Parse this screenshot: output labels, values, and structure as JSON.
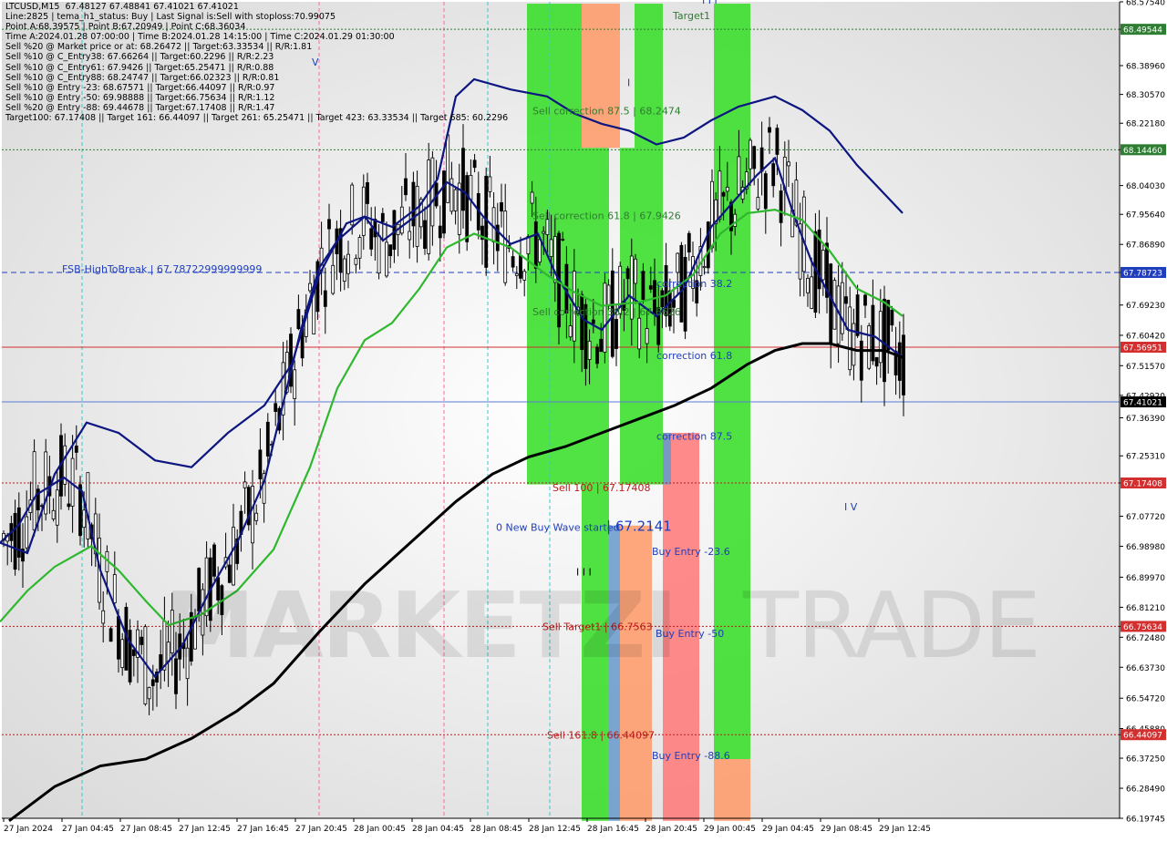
{
  "info": {
    "lines": [
      "LTCUSD,M15  67.48127 67.48841 67.41021 67.41021",
      "Line:2825 | tema_h1_status: Buy | Last Signal is:Sell with stoploss:70.99075",
      "Point A:68.39575 | Point B:67.20949 | Point C:68.36034",
      "Time A:2024.01.28 07:00:00 | Time B:2024.01.28 14:15:00 | Time C:2024.01.29 01:30:00",
      "Sell %20 @ Market price or at: 68.26472 || Target:63.33534 || R/R:1.81",
      "Sell %10 @ C_Entry38: 67.66264 || Target:60.2296 || R/R:2.23",
      "Sell %10 @ C_Entry61: 67.9426 || Target:65.25471 || R/R:0.88",
      "Sell %10 @ C_Entry88: 68.24747 || Target:66.02323 || R/R:0.81",
      "Sell %10 @ Entry -23: 68.67571 || Target:66.44097 || R/R:0.97",
      "Sell %10 @ Entry -50: 69.98888 || Target:66.75634 || R/R:1.12",
      "Sell %20 @ Entry -88: 69.44678 || Target:67.17408 || R/R:1.47",
      "Target100: 67.17408 || Target 161: 66.44097 || Target 261: 65.25471 || Target 423: 63.33534 || Target 685: 60.2296"
    ]
  },
  "watermark": {
    "left": "MARKETZI",
    "right": "TRADE"
  },
  "chart_data": {
    "type": "candlestick",
    "symbol": "LTCUSD",
    "timeframe": "M15",
    "ylim": [
      66.19745,
      68.5754
    ],
    "y_ticks": [
      "68.57540",
      "68.49544",
      "68.38960",
      "68.30570",
      "68.22180",
      "68.14460",
      "68.04030",
      "67.95640",
      "67.86890",
      "67.78723",
      "67.69230",
      "67.60420",
      "67.51570",
      "67.42920",
      "67.36390",
      "67.25310",
      "67.17408",
      "67.07720",
      "66.98980",
      "66.89970",
      "66.81210",
      "66.75634",
      "66.72480",
      "66.63730",
      "66.54720",
      "66.45880",
      "66.44097",
      "66.37250",
      "66.28490",
      "66.19745"
    ],
    "x_ticks": [
      "27 Jan 2024",
      "27 Jan 04:45",
      "27 Jan 08:45",
      "27 Jan 12:45",
      "27 Jan 16:45",
      "27 Jan 20:45",
      "28 Jan 00:45",
      "28 Jan 04:45",
      "28 Jan 08:45",
      "28 Jan 12:45",
      "28 Jan 16:45",
      "28 Jan 20:45",
      "29 Jan 00:45",
      "29 Jan 04:45",
      "29 Jan 08:45",
      "29 Jan 12:45"
    ],
    "current_price": 67.41021,
    "price_tags": [
      {
        "value": 68.49544,
        "label": "68.49544",
        "color": "#2e7d32"
      },
      {
        "value": 68.1446,
        "label": "68.14460",
        "color": "#2e7d32"
      },
      {
        "value": 67.78723,
        "label": "67.78723",
        "color": "#1f3fbf"
      },
      {
        "value": 67.56951,
        "label": "67.56951",
        "color": "#d32f2f"
      },
      {
        "value": 67.41021,
        "label": "67.41021",
        "color": "#000000"
      },
      {
        "value": 67.17408,
        "label": "67.17408",
        "color": "#d32f2f"
      },
      {
        "value": 66.75634,
        "label": "66.75634",
        "color": "#d32f2f"
      },
      {
        "value": 66.44097,
        "label": "66.44097",
        "color": "#d32f2f"
      }
    ],
    "levels": [
      {
        "value": 68.49544,
        "style": "dotted",
        "color": "#2e7d32"
      },
      {
        "value": 68.1446,
        "style": "dotted",
        "color": "#2e7d32"
      },
      {
        "value": 67.78723,
        "style": "dashed",
        "color": "#1f3fbf"
      },
      {
        "value": 67.56951,
        "style": "solid",
        "color": "#d32f2f"
      },
      {
        "value": 67.41021,
        "style": "solid",
        "color": "#5a7bd6"
      },
      {
        "value": 67.17408,
        "style": "dotted",
        "color": "#b71c1c"
      },
      {
        "value": 66.75634,
        "style": "dotted",
        "color": "#b71c1c"
      },
      {
        "value": 66.44097,
        "style": "dotted",
        "color": "#b71c1c"
      }
    ],
    "annotations": [
      {
        "text": "FSB-HighToBreak | 67.78722999999999",
        "y": 67.78723,
        "color": "#1f3fbf"
      },
      {
        "text": "Target1",
        "y": 68.525,
        "color": "#2e7d32"
      },
      {
        "text": "Sell correction 87.5 | 68.2474",
        "y": 68.2474,
        "color": "#2e7d32"
      },
      {
        "text": "Sell correction 61.8 | 67.9426",
        "y": 67.9426,
        "color": "#2e7d32"
      },
      {
        "text": "Sell correction 38.2 | 67.6626",
        "y": 67.6626,
        "color": "#2e7d32"
      },
      {
        "text": "correction 38.2",
        "y": 67.745,
        "color": "#1f3fbf"
      },
      {
        "text": "correction 61.8",
        "y": 67.535,
        "color": "#1f3fbf"
      },
      {
        "text": "correction 87.5",
        "y": 67.3,
        "color": "#1f3fbf"
      },
      {
        "text": "Sell 100 | 67.17408",
        "y": 67.15,
        "color": "#b71c1c"
      },
      {
        "text": "0 New Buy Wave started",
        "y": 67.035,
        "color": "#1f3fbf"
      },
      {
        "text": "| 67.2141",
        "y": 67.035,
        "color": "#1f3fbf"
      },
      {
        "text": "Buy Entry -23.6",
        "y": 66.965,
        "color": "#1f3fbf"
      },
      {
        "text": "Sell Target1 | 66.7563",
        "y": 66.745,
        "color": "#b71c1c"
      },
      {
        "text": "Buy Entry -50",
        "y": 66.725,
        "color": "#1f3fbf"
      },
      {
        "text": "Sell 161.8 | 66.44097",
        "y": 66.43,
        "color": "#b71c1c"
      },
      {
        "text": "Buy Entry -88.6",
        "y": 66.37,
        "color": "#1f3fbf"
      },
      {
        "text": "V",
        "y": 68.39,
        "color": "#1f3fbf"
      },
      {
        "text": "I V",
        "y": 67.095,
        "color": "#1f3fbf"
      },
      {
        "text": "I",
        "y": 68.33,
        "color": "#1f3fbf"
      },
      {
        "text": "I I I",
        "y": 68.57,
        "color": "#1f3fbf"
      },
      {
        "text": "I I I",
        "y": 66.905,
        "color": "#000000"
      }
    ],
    "series": [
      {
        "name": "",
        "color": "#0d1680",
        "points": [
          [
            0,
            67.0
          ],
          [
            30,
            66.97
          ],
          [
            60,
            67.2
          ],
          [
            95,
            67.35
          ],
          [
            130,
            67.32
          ],
          [
            170,
            67.24
          ],
          [
            210,
            67.22
          ],
          [
            250,
            67.32
          ],
          [
            290,
            67.4
          ],
          [
            320,
            67.52
          ],
          [
            350,
            67.78
          ],
          [
            380,
            67.93
          ],
          [
            400,
            67.95
          ],
          [
            430,
            67.92
          ],
          [
            460,
            67.98
          ],
          [
            480,
            68.06
          ],
          [
            500,
            68.3
          ],
          [
            520,
            68.35
          ],
          [
            560,
            68.32
          ],
          [
            600,
            68.3
          ],
          [
            630,
            68.25
          ],
          [
            660,
            68.22
          ],
          [
            690,
            68.2
          ],
          [
            720,
            68.16
          ],
          [
            750,
            68.18
          ],
          [
            780,
            68.23
          ],
          [
            810,
            68.27
          ],
          [
            850,
            68.3
          ],
          [
            880,
            68.26
          ],
          [
            910,
            68.2
          ],
          [
            940,
            68.1
          ],
          [
            965,
            68.03
          ],
          [
            990,
            67.96
          ]
        ]
      },
      {
        "name": "",
        "color": "#0d1680",
        "points": [
          [
            0,
            67.0
          ],
          [
            20,
            67.05
          ],
          [
            40,
            67.14
          ],
          [
            70,
            67.19
          ],
          [
            90,
            67.15
          ],
          [
            110,
            66.92
          ],
          [
            140,
            66.72
          ],
          [
            170,
            66.61
          ],
          [
            200,
            66.7
          ],
          [
            230,
            66.86
          ],
          [
            260,
            67.0
          ],
          [
            290,
            67.18
          ],
          [
            310,
            67.4
          ],
          [
            330,
            67.62
          ],
          [
            350,
            67.8
          ],
          [
            370,
            67.88
          ],
          [
            400,
            67.95
          ],
          [
            420,
            67.88
          ],
          [
            440,
            67.92
          ],
          [
            470,
            67.98
          ],
          [
            490,
            68.05
          ],
          [
            510,
            68.02
          ],
          [
            530,
            67.95
          ],
          [
            560,
            67.87
          ],
          [
            590,
            67.9
          ],
          [
            610,
            67.78
          ],
          [
            640,
            67.65
          ],
          [
            660,
            67.62
          ],
          [
            690,
            67.72
          ],
          [
            720,
            67.66
          ],
          [
            750,
            67.74
          ],
          [
            780,
            67.92
          ],
          [
            800,
            67.98
          ],
          [
            830,
            68.07
          ],
          [
            850,
            68.12
          ],
          [
            870,
            67.96
          ],
          [
            890,
            67.82
          ],
          [
            910,
            67.72
          ],
          [
            930,
            67.62
          ],
          [
            960,
            67.6
          ],
          [
            990,
            67.54
          ]
        ]
      },
      {
        "name": "",
        "color": "#2eb82e",
        "points": [
          [
            0,
            66.77
          ],
          [
            30,
            66.86
          ],
          [
            60,
            66.93
          ],
          [
            100,
            66.99
          ],
          [
            130,
            66.92
          ],
          [
            160,
            66.83
          ],
          [
            185,
            66.76
          ],
          [
            220,
            66.79
          ],
          [
            260,
            66.86
          ],
          [
            300,
            66.98
          ],
          [
            340,
            67.22
          ],
          [
            370,
            67.45
          ],
          [
            400,
            67.59
          ],
          [
            430,
            67.64
          ],
          [
            460,
            67.74
          ],
          [
            490,
            67.86
          ],
          [
            520,
            67.9
          ],
          [
            560,
            67.86
          ],
          [
            600,
            67.78
          ],
          [
            630,
            67.73
          ],
          [
            660,
            67.69
          ],
          [
            700,
            67.7
          ],
          [
            730,
            67.72
          ],
          [
            760,
            67.78
          ],
          [
            790,
            67.9
          ],
          [
            820,
            67.96
          ],
          [
            850,
            67.97
          ],
          [
            880,
            67.94
          ],
          [
            910,
            67.85
          ],
          [
            940,
            67.74
          ],
          [
            970,
            67.7
          ],
          [
            990,
            67.66
          ]
        ]
      },
      {
        "name": "",
        "color": "#000000",
        "points": [
          [
            10,
            66.19
          ],
          [
            60,
            66.29
          ],
          [
            110,
            66.35
          ],
          [
            160,
            66.37
          ],
          [
            210,
            66.43
          ],
          [
            260,
            66.51
          ],
          [
            300,
            66.59
          ],
          [
            350,
            66.74
          ],
          [
            400,
            66.88
          ],
          [
            450,
            67.0
          ],
          [
            500,
            67.12
          ],
          [
            540,
            67.2
          ],
          [
            580,
            67.25
          ],
          [
            620,
            67.28
          ],
          [
            660,
            67.32
          ],
          [
            700,
            67.36
          ],
          [
            740,
            67.4
          ],
          [
            780,
            67.45
          ],
          [
            820,
            67.52
          ],
          [
            850,
            67.56
          ],
          [
            880,
            67.58
          ],
          [
            910,
            67.58
          ],
          [
            940,
            67.56
          ],
          [
            970,
            67.56
          ],
          [
            990,
            67.54
          ]
        ]
      }
    ],
    "zones": [
      {
        "x0": 578,
        "x1": 638,
        "y0": 68.57,
        "y1": 67.17,
        "color": "#33dd22"
      },
      {
        "x0": 638,
        "x1": 680,
        "y0": 68.57,
        "y1": 68.15,
        "color": "#ff9966"
      },
      {
        "x0": 638,
        "x1": 668,
        "y0": 68.15,
        "y1": 66.19,
        "color": "#33dd22"
      },
      {
        "x0": 668,
        "x1": 680,
        "y0": 67.05,
        "y1": 66.19,
        "color": "#6699cc"
      },
      {
        "x0": 680,
        "x1": 715,
        "y0": 67.05,
        "y1": 66.19,
        "color": "#ff9966"
      },
      {
        "x0": 680,
        "x1": 696,
        "y0": 68.15,
        "y1": 67.17,
        "color": "#33dd22"
      },
      {
        "x0": 696,
        "x1": 727,
        "y0": 68.57,
        "y1": 67.17,
        "color": "#33dd22"
      },
      {
        "x0": 727,
        "x1": 767,
        "y0": 67.32,
        "y1": 66.19,
        "color": "#ff7777"
      },
      {
        "x0": 727,
        "x1": 736,
        "y0": 67.32,
        "y1": 67.17,
        "color": "#6699cc"
      },
      {
        "x0": 783,
        "x1": 823,
        "y0": 68.57,
        "y1": 66.37,
        "color": "#33dd22"
      },
      {
        "x0": 783,
        "x1": 823,
        "y0": 66.37,
        "y1": 66.19,
        "color": "#ff9966"
      }
    ],
    "vlines": [
      {
        "x": 350,
        "color": "#ff66aa"
      },
      {
        "x": 487,
        "color": "#ff66aa"
      },
      {
        "x": 535,
        "color": "#33cccc"
      },
      {
        "x": 603,
        "color": "#33cccc"
      },
      {
        "x": 90,
        "color": "#33cccc"
      }
    ]
  }
}
